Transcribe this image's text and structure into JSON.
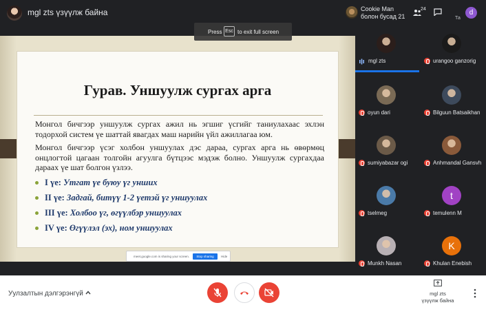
{
  "topbar": {
    "presenter_title": "mgl zts үзүүлж байна",
    "cookie_name_line1": "Cookie Man",
    "cookie_name_line2": "болон бусад 21",
    "people_count": "24",
    "ta_label": "Та",
    "self_initial": "d"
  },
  "toast": {
    "press": "Press",
    "key": "Esc",
    "rest": "to exit full screen"
  },
  "slide": {
    "title": "Гурав. Уншуулж сургах арга",
    "paragraph1": "Монгол бичгээр уншуулж сургах ажил нь эгшиг үсгийг таниулахаас эхлэн тодорхой систем үе шаттай явагдах маш нарийн үйл ажиллагаа юм.",
    "paragraph2": "Монгол бичгээр үсэг холбон уншуулах дэс дараа, сургах арга нь өвөрмөц онцлогтой цагаан толгойн агуулга бүтцээс мэдэж болно. Уншуулж сургахдаа дараах үе шат болгон үзлээ.",
    "bullets": [
      {
        "label": "I үе:",
        "text": "Утгат үе буюу үг унших"
      },
      {
        "label": "II үе:",
        "text": "Задгай, битүү 1-2 үетэй үг уншуулах"
      },
      {
        "label": "III үе:",
        "text": "Холбоо үг, өгүүлбэр уншуулах"
      },
      {
        "label": "IV үе:",
        "text": "Өгүүлэл (эх), ном уншуулах"
      }
    ]
  },
  "share_bar": {
    "text": "meet.google.com is sharing your screen.",
    "stop": "Stop sharing",
    "hide": "Hide"
  },
  "participants": [
    {
      "name": "mgl zts",
      "avatar_color": "#2b1e1b",
      "speaking": true
    },
    {
      "name": "urangoo ganzorig",
      "avatar_color": "#1a1a1a",
      "speaking": false
    },
    {
      "name": "oyun dari",
      "avatar_color": "#7a6a55",
      "speaking": false
    },
    {
      "name": "Bilguun Batsaikhan",
      "avatar_color": "#3d4a5c",
      "speaking": false
    },
    {
      "name": "sumiyabazar ogi",
      "avatar_color": "#6b5a48",
      "speaking": false
    },
    {
      "name": "Anhmandal Gansvh",
      "avatar_color": "#8a5a3a",
      "speaking": false
    },
    {
      "name": "tselmeg",
      "avatar_color": "#4a7aa8",
      "speaking": false
    },
    {
      "name": "temulenn M",
      "avatar_color": "#a142c4",
      "letter": "t",
      "speaking": false
    },
    {
      "name": "Munkh Nasan",
      "avatar_color": "#b8b0b4",
      "speaking": false
    },
    {
      "name": "Khulan Enebish",
      "avatar_color": "#e8710a",
      "letter": "K",
      "speaking": false
    }
  ],
  "bottombar": {
    "meeting_label": "Уулзалтын дэлгэрэнгүй",
    "present_line1": "mgl zts",
    "present_line2": "үзүүлж байна"
  },
  "colors": {
    "accent": "#1a73e8",
    "danger": "#ea4335"
  }
}
